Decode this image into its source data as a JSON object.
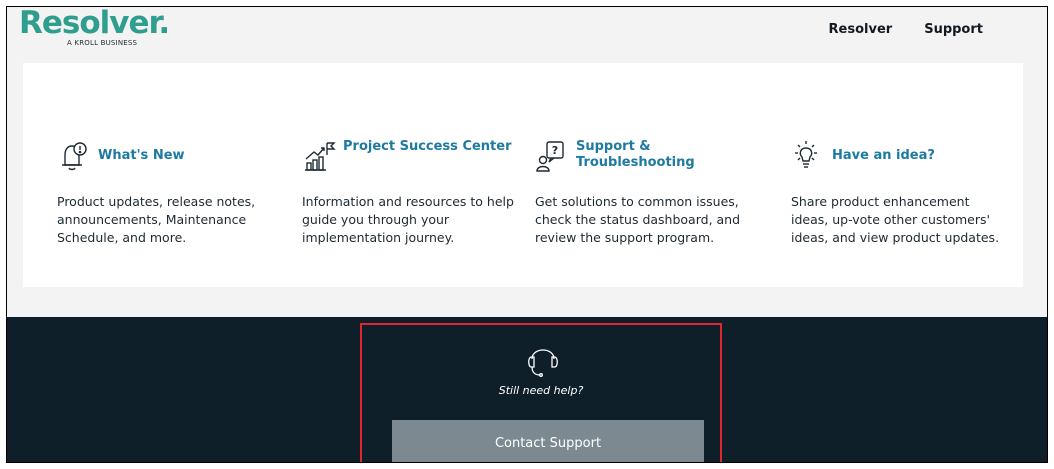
{
  "brand": {
    "logo_text": "Resolver.",
    "logo_subtext": "A KROLL BUSINESS",
    "color": "#2f9e8f"
  },
  "nav": {
    "items": [
      {
        "label": "Resolver"
      },
      {
        "label": "Support"
      }
    ]
  },
  "cards": [
    {
      "icon": "bell-alert-icon",
      "title": "What's New",
      "description": "Product updates, release notes, announcements, Maintenance Schedule, and more."
    },
    {
      "icon": "chart-flag-icon",
      "title": "Project Success Center",
      "description": "Information and resources to help guide you through your implementation journey."
    },
    {
      "icon": "person-question-icon",
      "title": "Support & Troubleshooting",
      "description": "Get solutions to common issues, check the status dashboard, and review the support program."
    },
    {
      "icon": "lightbulb-icon",
      "title": "Have an idea?",
      "description": "Share product enhancement ideas, up-vote other customers' ideas, and view product updates."
    }
  ],
  "help": {
    "icon": "headset-icon",
    "prompt": "Still need help?",
    "button_label": "Contact Support"
  },
  "colors": {
    "link": "#1d7aa0",
    "footer_bg": "#0f1f29",
    "button_bg": "#7d8990",
    "highlight_border": "#e0262e"
  }
}
